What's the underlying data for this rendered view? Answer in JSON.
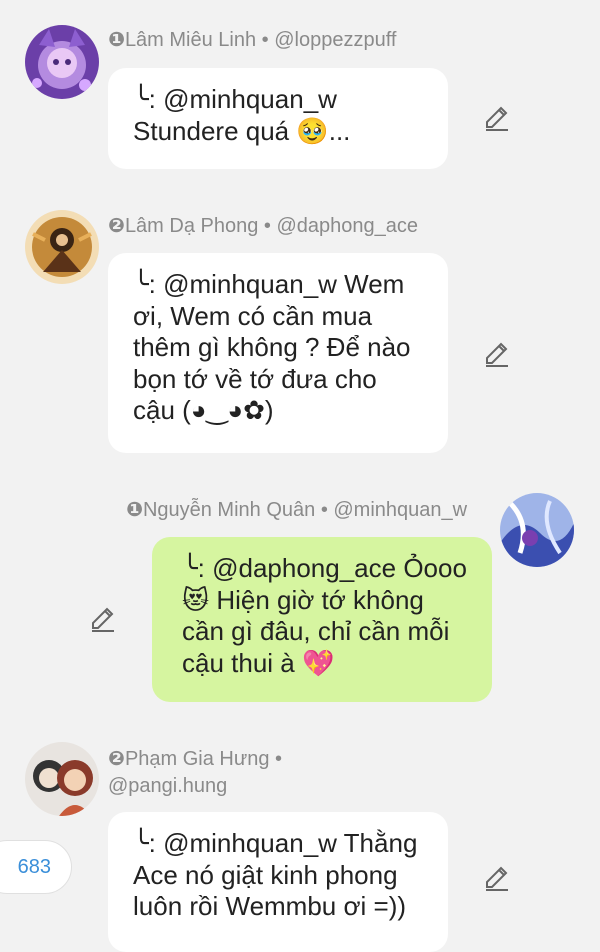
{
  "messages": [
    {
      "num": "❶",
      "name": "Lâm Miêu Linh • @loppezzpuff",
      "lines": [
        "╰: @minhquan_w",
        "Stundere quá 🥹..."
      ]
    },
    {
      "num": "❷",
      "name": "Lâm Dạ Phong • @daphong_ace",
      "lines": [
        "╰: @minhquan_w Wem",
        "ơi, Wem có cần mua",
        "thêm gì không ? Để nào",
        "bọn tớ về tớ đưa cho",
        "cậu (◕‿◕✿)"
      ]
    },
    {
      "num": "❶",
      "name": "Nguyễn Minh Quân • @minhquan_w",
      "lines": [
        "╰: @daphong_ace Ỏooo",
        "😻 Hiện giờ tớ không",
        "cần gì đâu, chỉ cần mỗi",
        "cậu thui à 💖"
      ]
    },
    {
      "num": "❷",
      "name_line1": "Phạm Gia Hưng •",
      "name_line2": "@pangi.hung",
      "lines": [
        "╰: @minhquan_w Thằng",
        "Ace nó giật kinh phong",
        "luôn rồi Wemmbu ơi =))"
      ]
    }
  ],
  "reaction_count": "683",
  "colors": {
    "background": "#f2f2f2",
    "bubble": "#ffffff",
    "own_bubble": "#d6f5a0",
    "meta_text": "#8a8a8a",
    "count_text": "#3b8fd9"
  },
  "icons": [
    "pencil-edit-icon"
  ]
}
